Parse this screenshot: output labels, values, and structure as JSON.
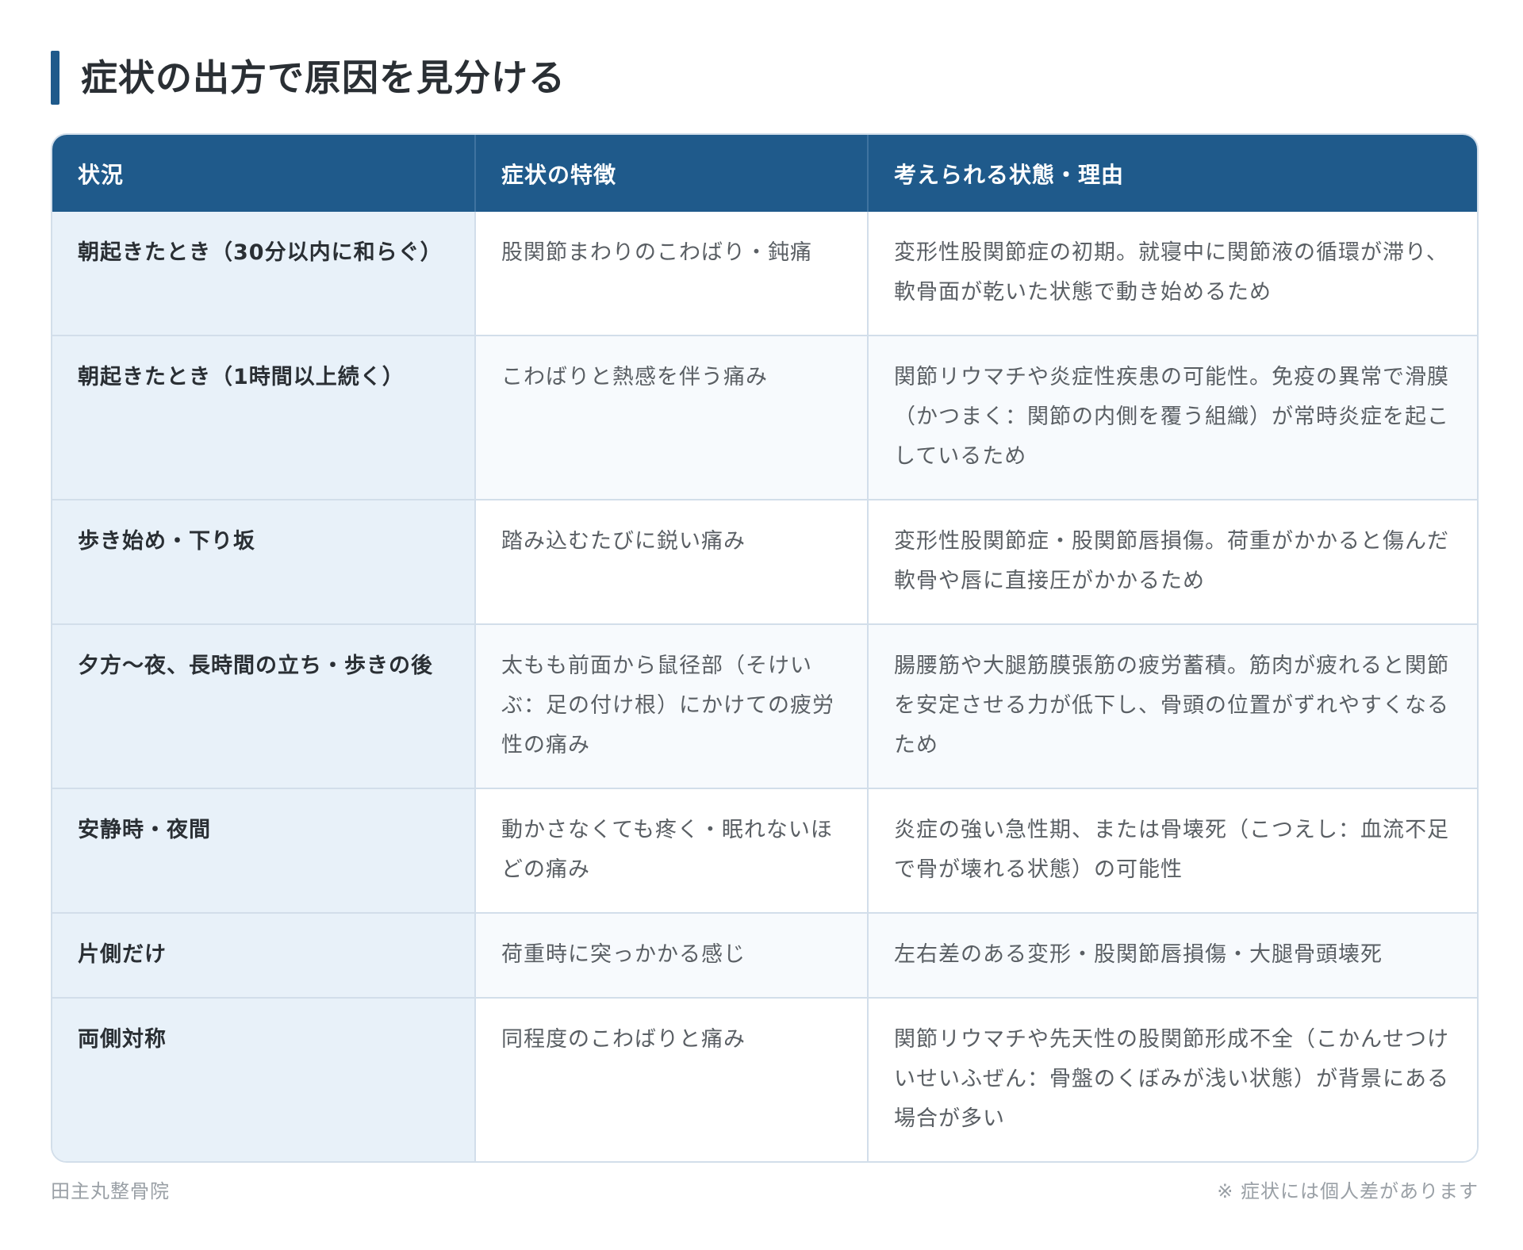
{
  "title": "症状の出方で原因を見分ける",
  "table": {
    "headers": [
      "状況",
      "症状の特徴",
      "考えられる状態・理由"
    ],
    "rows": [
      {
        "situation": "朝起きたとき（30分以内に和らぐ）",
        "symptom": "股関節まわりのこわばり・鈍痛",
        "reason": "変形性股関節症の初期。就寝中に関節液の循環が滞り、軟骨面が乾いた状態で動き始めるため"
      },
      {
        "situation": "朝起きたとき（1時間以上続く）",
        "symptom": "こわばりと熱感を伴う痛み",
        "reason": "関節リウマチや炎症性疾患の可能性。免疫の異常で滑膜（かつまく：関節の内側を覆う組織）が常時炎症を起こしているため"
      },
      {
        "situation": "歩き始め・下り坂",
        "symptom": "踏み込むたびに鋭い痛み",
        "reason": "変形性股関節症・股関節唇損傷。荷重がかかると傷んだ軟骨や唇に直接圧がかかるため"
      },
      {
        "situation": "夕方〜夜、長時間の立ち・歩きの後",
        "symptom": "太もも前面から鼠径部（そけいぶ：足の付け根）にかけての疲労性の痛み",
        "reason": "腸腰筋や大腿筋膜張筋の疲労蓄積。筋肉が疲れると関節を安定させる力が低下し、骨頭の位置がずれやすくなるため"
      },
      {
        "situation": "安静時・夜間",
        "symptom": "動かさなくても疼く・眠れないほどの痛み",
        "reason": "炎症の強い急性期、または骨壊死（こつえし：血流不足で骨が壊れる状態）の可能性"
      },
      {
        "situation": "片側だけ",
        "symptom": "荷重時に突っかかる感じ",
        "reason": "左右差のある変形・股関節唇損傷・大腿骨頭壊死"
      },
      {
        "situation": "両側対称",
        "symptom": "同程度のこわばりと痛み",
        "reason": "関節リウマチや先天性の股関節形成不全（こかんせつけいせいふぜん：骨盤のくぼみが浅い状態）が背景にある場合が多い"
      }
    ]
  },
  "footer": {
    "clinic": "田主丸整骨院",
    "note": "※ 症状には個人差があります"
  },
  "colors": {
    "accent": "#1f5a8b",
    "first_column_bg": "#e8f1f9",
    "border": "#d2deea"
  }
}
